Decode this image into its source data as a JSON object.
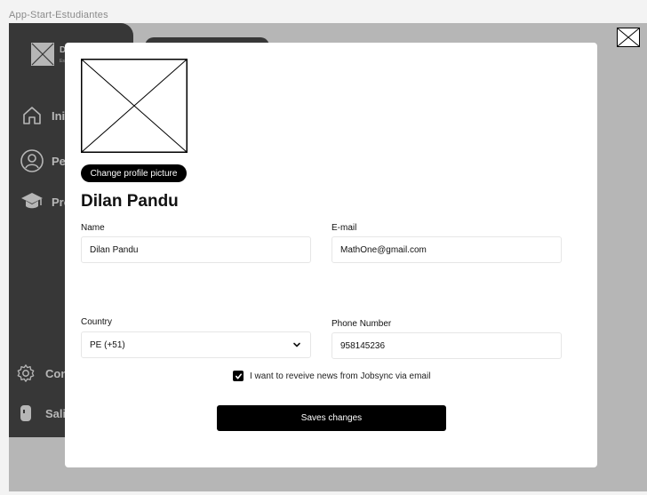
{
  "frame": {
    "title": "App-Start-Estudiantes"
  },
  "sidebar": {
    "logo_icon": "image-placeholder-icon",
    "initial": "D",
    "subtitle": "Es",
    "items": [
      {
        "label": "Ini",
        "icon": "home-icon"
      },
      {
        "label": "Pe",
        "icon": "user-circle-icon"
      },
      {
        "label": "Pro",
        "icon": "graduation-cap-icon"
      },
      {
        "label": "Con",
        "icon": "gear-icon"
      },
      {
        "label": "Sali",
        "icon": "logout-icon"
      }
    ]
  },
  "modal": {
    "avatar_icon": "image-placeholder-icon",
    "change_picture_label": "Change profile picture",
    "profile_name": "Dilan Pandu",
    "fields": {
      "name": {
        "label": "Name",
        "value": "Dilan Pandu"
      },
      "email": {
        "label": "E-mail",
        "value": "MathOne@gmail.com"
      },
      "country": {
        "label": "Country",
        "value": "PE (+51)"
      },
      "phone": {
        "label": "Phone Number",
        "value": "958145236"
      }
    },
    "newsletter": {
      "label": "I want to reveive news from Jobsync via email",
      "checked": true
    },
    "save_label": "Saves changes",
    "close_icon": "close-icon"
  },
  "colors": {
    "primary": "#000000",
    "overlay": "#b0b0b0",
    "background": "#ffffff"
  }
}
